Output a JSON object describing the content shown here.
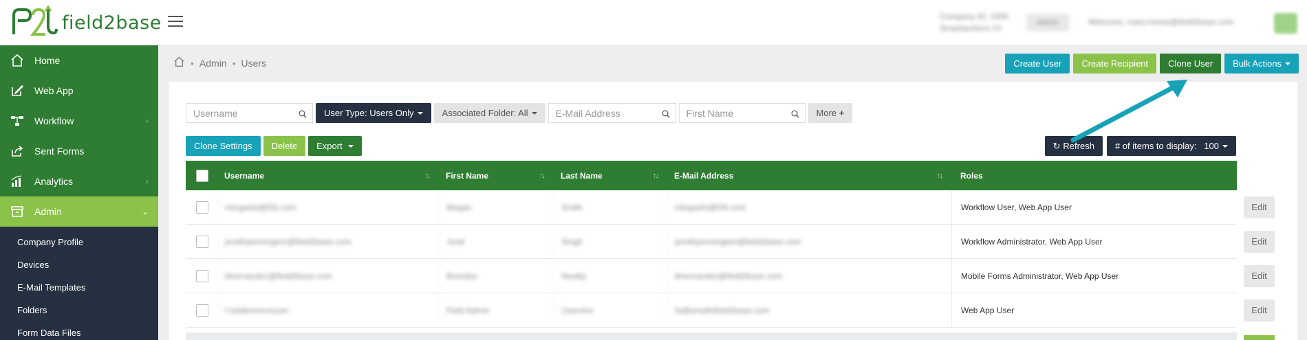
{
  "app": {
    "logo_text": "field2base",
    "company_label": "Company ID: 1000",
    "company_sub": "Smartworkers #1",
    "account_button": "Admin",
    "welcome_text": "Welcome, mary.morse@field2base.com"
  },
  "sidebar": {
    "items": [
      {
        "label": "Home",
        "icon": "home-icon",
        "has_chevron": false
      },
      {
        "label": "Web App",
        "icon": "edit-icon",
        "has_chevron": false
      },
      {
        "label": "Workflow",
        "icon": "workflow-icon",
        "has_chevron": true
      },
      {
        "label": "Sent Forms",
        "icon": "share-icon",
        "has_chevron": false
      },
      {
        "label": "Analytics",
        "icon": "bar-chart-icon",
        "has_chevron": true
      },
      {
        "label": "Admin",
        "icon": "archive-icon",
        "has_chevron": true,
        "active": true
      }
    ],
    "admin_subitems": [
      "Company Profile",
      "Devices",
      "E-Mail Templates",
      "Folders",
      "Form Data Files"
    ]
  },
  "breadcrumb": [
    "Admin",
    "Users"
  ],
  "top_actions": {
    "create_user": "Create User",
    "create_recipient": "Create Recipient",
    "clone_user": "Clone User",
    "bulk_actions": "Bulk Actions"
  },
  "filters": {
    "username_placeholder": "Username",
    "user_type": "User Type: Users Only",
    "associated_folder": "Associated Folder: All",
    "email_placeholder": "E-Mail Address",
    "first_name_placeholder": "First Name",
    "more": "More"
  },
  "toolbar": {
    "clone_settings": "Clone Settings",
    "delete": "Delete",
    "export": "Export",
    "refresh": "Refresh",
    "items_label": "# of items to display:",
    "items_value": "100"
  },
  "table": {
    "headers": {
      "username": "Username",
      "first_name": "First Name",
      "last_name": "Last Name",
      "email": "E-Mail Address",
      "roles": "Roles"
    },
    "rows": [
      {
        "username": "mtogashi@f2b.com",
        "first": "Megan",
        "last": "Smith",
        "email": "mtogashi@f2b.com",
        "roles": "Workflow User, Web App User"
      },
      {
        "username": "jsmithpennington@field2base.com",
        "first": "Jordi",
        "last": "Singh",
        "email": "jsmithpennington@field2base.com",
        "roles": "Workflow Administrator, Web App User"
      },
      {
        "username": "bhernandez@field2base.com",
        "first": "Brendan",
        "last": "Newby",
        "email": "bhernandez@field2base.com",
        "roles": "Mobile Forms Administrator, Web App User"
      },
      {
        "username": "f.relationsrunuser",
        "first": "Field Admin",
        "last": "Uservice",
        "email": "fa@emailsfield2base.com",
        "roles": "Web App User"
      }
    ],
    "edit_label": "Edit"
  },
  "colors": {
    "brand_green": "#2e7d32",
    "lime": "#8bc34a",
    "teal": "#17a2b8",
    "navy": "#253041"
  }
}
